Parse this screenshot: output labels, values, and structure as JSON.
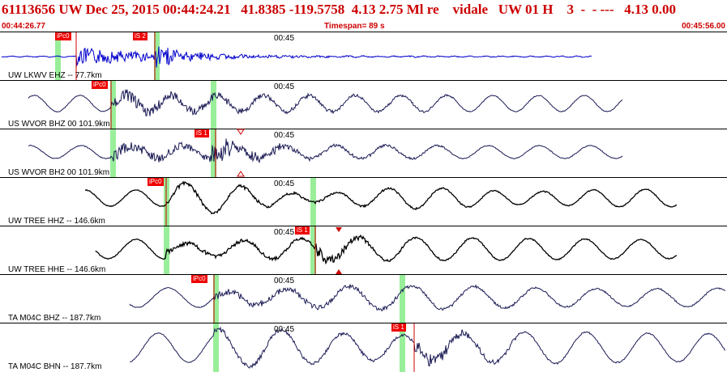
{
  "header": {
    "title": "61113656 UW Dec 25, 2015 00:44:24.21   41.8385 -119.5758  4.13 2.75 Ml re    vidale   UW 01 H    3  -  - ---   4.13 0.00",
    "start_time": "00:44:26.77",
    "timespan": "Timespan=  89 s",
    "end_time": "00:45:56.00"
  },
  "traces": [
    {
      "label": "UW LKWV EHZ -- 77.7km",
      "tick": "00:45",
      "color": "#0000cc",
      "picks": [
        "iPc0",
        "iS 2"
      ]
    },
    {
      "label": "US WVOR BHZ 00 101.9km",
      "tick": "00:45",
      "color": "#1a1a55",
      "picks": [
        "iPc0"
      ]
    },
    {
      "label": "US WVOR BH2 00 101.9km",
      "tick": "00:45",
      "color": "#1a1a55",
      "picks": [
        "iS 1"
      ]
    },
    {
      "label": "UW TREE HHZ -- 146.6km",
      "tick": "00:45",
      "color": "#000000",
      "picks": [
        "iPc0"
      ]
    },
    {
      "label": "UW TREE HHE -- 146.6km",
      "tick": "00:45",
      "color": "#000000",
      "picks": [
        "iS 1"
      ]
    },
    {
      "label": "TA M04C BHZ -- 187.7km",
      "tick": "00:45",
      "color": "#1a1a55",
      "picks": [
        "iPc0"
      ]
    },
    {
      "label": "TA M04C BHN -- 187.7km",
      "tick": "00:45",
      "color": "#1a1a55",
      "picks": [
        "iS 1"
      ]
    }
  ]
}
